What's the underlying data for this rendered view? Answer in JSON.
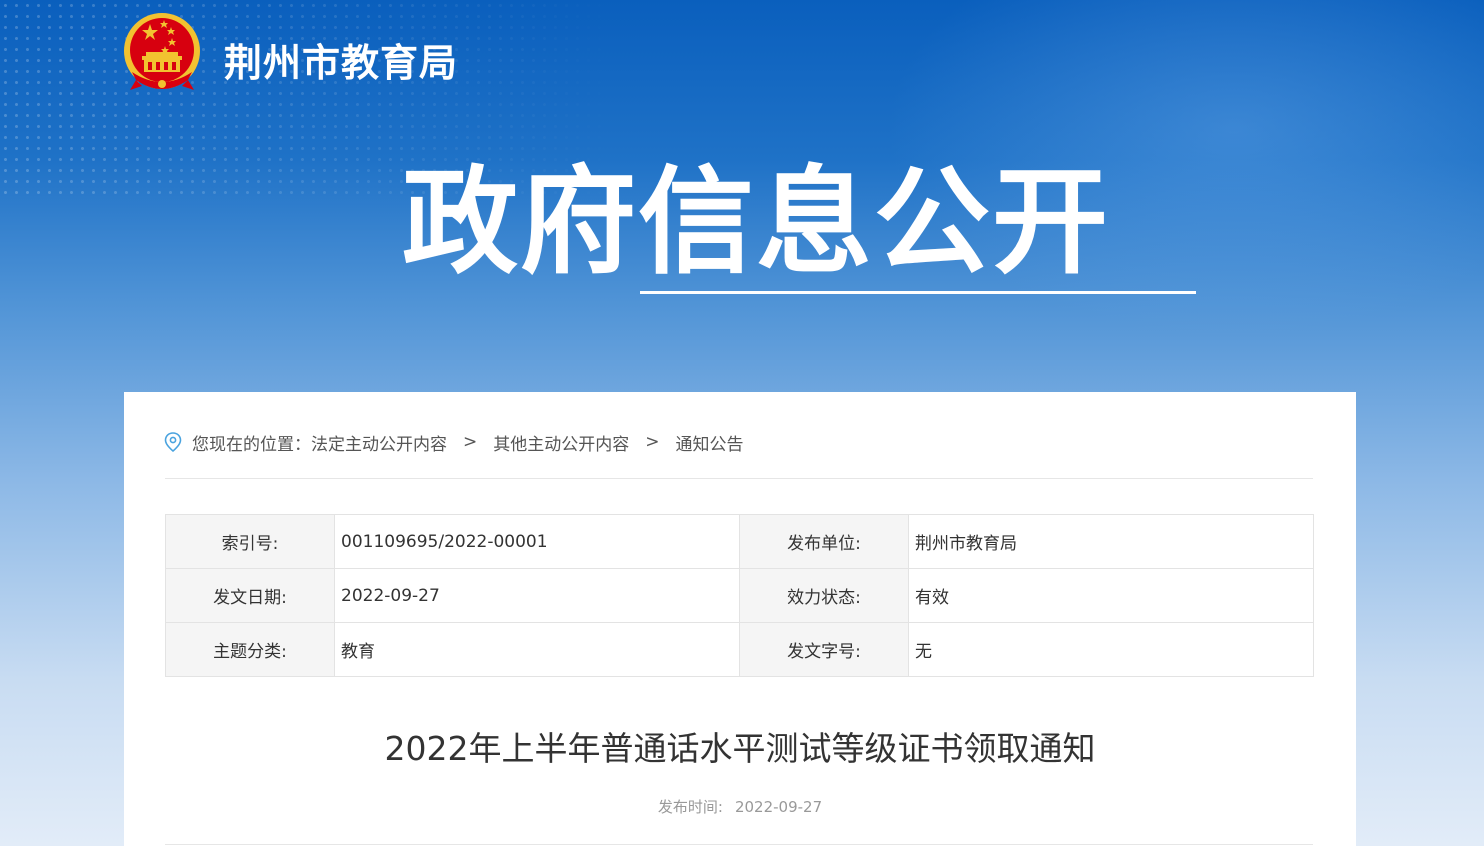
{
  "header": {
    "site_name": "荆州市教育局",
    "hero_title": "政府信息公开"
  },
  "breadcrumb": {
    "prefix": "您现在的位置：",
    "items": [
      "法定主动公开内容",
      "其他主动公开内容",
      "通知公告"
    ],
    "separator": ">"
  },
  "meta": {
    "rows": [
      {
        "k1": "索引号:",
        "v1": "001109695/2022-00001",
        "k2": "发布单位:",
        "v2": "荆州市教育局"
      },
      {
        "k1": "发文日期:",
        "v1": "2022-09-27",
        "k2": "效力状态:",
        "v2": "有效"
      },
      {
        "k1": "主题分类:",
        "v1": "教育",
        "k2": "发文字号:",
        "v2": "无"
      }
    ]
  },
  "article": {
    "title": "2022年上半年普通话水平测试等级证书领取通知",
    "pub_label": "发布时间:",
    "pub_date": "2022-09-27"
  },
  "colors": {
    "header_blue": "#0a5fbd",
    "emblem_red": "#d7000f",
    "emblem_gold": "#f2c230"
  },
  "icons": {
    "emblem": "national-emblem-icon",
    "location": "location-pin-icon"
  }
}
